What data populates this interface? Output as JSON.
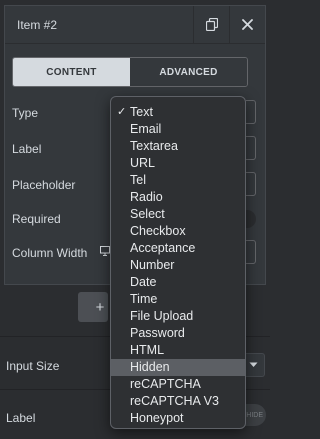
{
  "item": {
    "title": "Item #2"
  },
  "tabs": [
    {
      "label": "CONTENT"
    },
    {
      "label": "ADVANCED"
    }
  ],
  "fields": {
    "type_label": "Type",
    "label_label": "Label",
    "placeholder_label": "Placeholder",
    "required_label": "Required",
    "column_width_label": "Column Width"
  },
  "add_button": {
    "label": "+"
  },
  "sections": {
    "input_size_label": "Input Size",
    "label_label": "Label",
    "hide_toggle_text": "HIDE"
  },
  "dropdown": {
    "selected": "Text",
    "highlighted": "Hidden",
    "options": [
      "Text",
      "Email",
      "Textarea",
      "URL",
      "Tel",
      "Radio",
      "Select",
      "Checkbox",
      "Acceptance",
      "Number",
      "Date",
      "Time",
      "File Upload",
      "Password",
      "HTML",
      "Hidden",
      "reCAPTCHA",
      "reCAPTCHA V3",
      "Honeypot"
    ]
  },
  "colors": {
    "panel_bg": "#34383c",
    "page_bg": "#2b2d30",
    "tab_active_bg": "#d5dadf",
    "dropdown_bg": "#2e3033",
    "dropdown_hover": "#5c5f64"
  },
  "icons": {
    "duplicate": "duplicate-icon",
    "close": "close-icon",
    "responsive": "desktop-icon",
    "caret": "caret-down-icon",
    "check": "checkmark-icon"
  }
}
